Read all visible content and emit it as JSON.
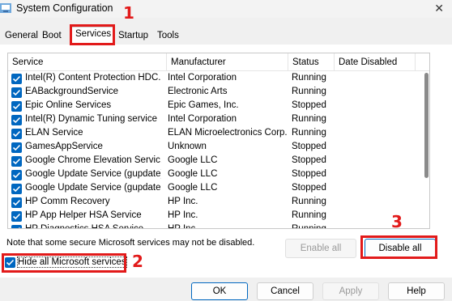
{
  "window": {
    "title": "System Configuration",
    "close": "✕"
  },
  "tabs": [
    "General",
    "Boot",
    "Services",
    "Startup",
    "Tools"
  ],
  "columns": [
    "Service",
    "Manufacturer",
    "Status",
    "Date Disabled"
  ],
  "services": [
    {
      "name": "Intel(R) Content Protection HDC...",
      "manufacturer": "Intel Corporation",
      "status": "Running"
    },
    {
      "name": "EABackgroundService",
      "manufacturer": "Electronic Arts",
      "status": "Running"
    },
    {
      "name": "Epic Online Services",
      "manufacturer": "Epic Games, Inc.",
      "status": "Stopped"
    },
    {
      "name": "Intel(R) Dynamic Tuning service",
      "manufacturer": "Intel Corporation",
      "status": "Running"
    },
    {
      "name": "ELAN Service",
      "manufacturer": "ELAN Microelectronics Corp.",
      "status": "Running"
    },
    {
      "name": "GamesAppService",
      "manufacturer": "Unknown",
      "status": "Stopped"
    },
    {
      "name": "Google Chrome Elevation Servic...",
      "manufacturer": "Google LLC",
      "status": "Stopped"
    },
    {
      "name": "Google Update Service (gupdate)",
      "manufacturer": "Google LLC",
      "status": "Stopped"
    },
    {
      "name": "Google Update Service (gupdatem)",
      "manufacturer": "Google LLC",
      "status": "Stopped"
    },
    {
      "name": "HP Comm Recovery",
      "manufacturer": "HP Inc.",
      "status": "Running"
    },
    {
      "name": "HP App Helper HSA Service",
      "manufacturer": "HP Inc.",
      "status": "Running"
    },
    {
      "name": "HP Diagnostics HSA Service",
      "manufacturer": "HP Inc.",
      "status": "Running"
    }
  ],
  "note": "Note that some secure Microsoft services may not be disabled.",
  "buttons": {
    "enable_all": "Enable all",
    "disable_all": "Disable all",
    "ok": "OK",
    "cancel": "Cancel",
    "apply": "Apply",
    "help": "Help"
  },
  "hide_ms": {
    "label": "Hide all Microsoft services",
    "checked": true
  },
  "annotations": [
    "1",
    "2",
    "3"
  ],
  "colors": {
    "accent": "#0067c0",
    "annotation": "#e21a1a"
  }
}
